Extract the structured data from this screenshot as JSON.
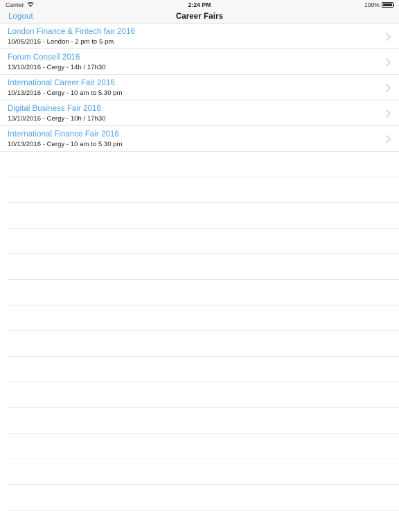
{
  "status_bar": {
    "carrier": "Carrier",
    "wifi_icon": "wifi-icon",
    "time": "2:24 PM",
    "battery_percent": "100%",
    "battery_icon": "battery-full-icon"
  },
  "nav_bar": {
    "left_button_label": "Logout",
    "title": "Career Fairs"
  },
  "colors": {
    "accent_blue": "#4da2e8",
    "bar_background": "#f7f7f7",
    "separator": "#e4e4e6",
    "chevron": "#d5d5d8"
  },
  "list": {
    "accessory_icon": "chevron-right-icon",
    "items": [
      {
        "title": "London Finance & Fintech fair 2016",
        "subtitle": "10/05/2016 - London - 2 pm to 5 pm"
      },
      {
        "title": "Forum Conseil 2016",
        "subtitle": "13/10/2016 - Cergy - 14h / 17h30"
      },
      {
        "title": "International Career Fair 2016",
        "subtitle": "10/13/2016 - Cergy - 10 am to 5.30 pm"
      },
      {
        "title": "Digital Business Fair 2016",
        "subtitle": "13/10/2016 - Cergy - 10h / 17h30"
      },
      {
        "title": "International Finance Fair 2016",
        "subtitle": "10/13/2016 - Cergy - 10 am to 5.30 pm"
      }
    ],
    "empty_row_count": 15
  }
}
